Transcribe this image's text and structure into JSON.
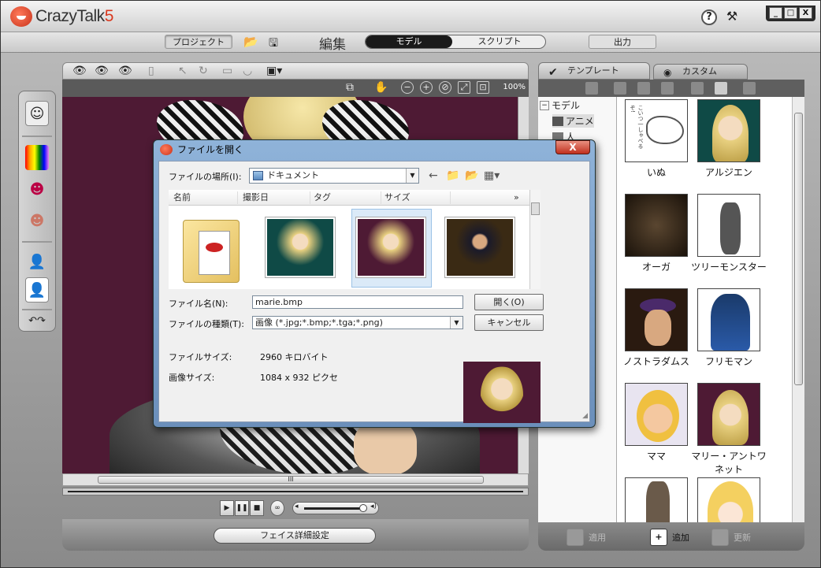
{
  "app": {
    "name": "CrazyTalk",
    "version": "5"
  },
  "window_controls": [
    "_",
    "□",
    "X"
  ],
  "menubar": {
    "project": "プロジェクト",
    "edit": "編集",
    "model": "モデル",
    "script": "スクリプト",
    "output": "出力"
  },
  "viewport": {
    "zoom": "100%",
    "hscroll_grip": "III",
    "face_detail_button": "フェイス詳細設定"
  },
  "right_panel": {
    "tab_template": "テンプレート",
    "tab_custom": "カスタム",
    "tree": [
      "モデル",
      "アニメ",
      "人"
    ],
    "gallery": [
      {
        "label": "いぬ",
        "dog_text": "こいつ一しゃべるぞ!"
      },
      {
        "label": "アルジエン"
      },
      {
        "label": "オーガ"
      },
      {
        "label": "ツリーモンスター"
      },
      {
        "label": "ノストラダムス"
      },
      {
        "label": "フリモマン"
      },
      {
        "label": "ママ"
      },
      {
        "label": "マリー・アントワネット"
      },
      {
        "label": ""
      },
      {
        "label": ""
      }
    ],
    "apply": "適用",
    "add": "追加",
    "update": "更新"
  },
  "dialog": {
    "title": "ファイルを開く",
    "close": "X",
    "location_label": "ファイルの場所(I):",
    "location_value": "ドキュメント",
    "columns": [
      "名前",
      "撮影日",
      "タグ",
      "サイズ"
    ],
    "more_columns": "»",
    "filename_label": "ファイル名(N):",
    "filename_value": "marie.bmp",
    "filetype_label": "ファイルの種類(T):",
    "filetype_value": "画像 (*.jpg;*.bmp;*.tga;*.png)",
    "open_button": "開く(O)",
    "cancel_button": "キャンセル",
    "filesize_label": "ファイルサイズ:",
    "filesize_value": "2960 キロバイト",
    "imagesize_label": "画像サイズ:",
    "imagesize_value": "1084 x 932 ピクセ"
  }
}
